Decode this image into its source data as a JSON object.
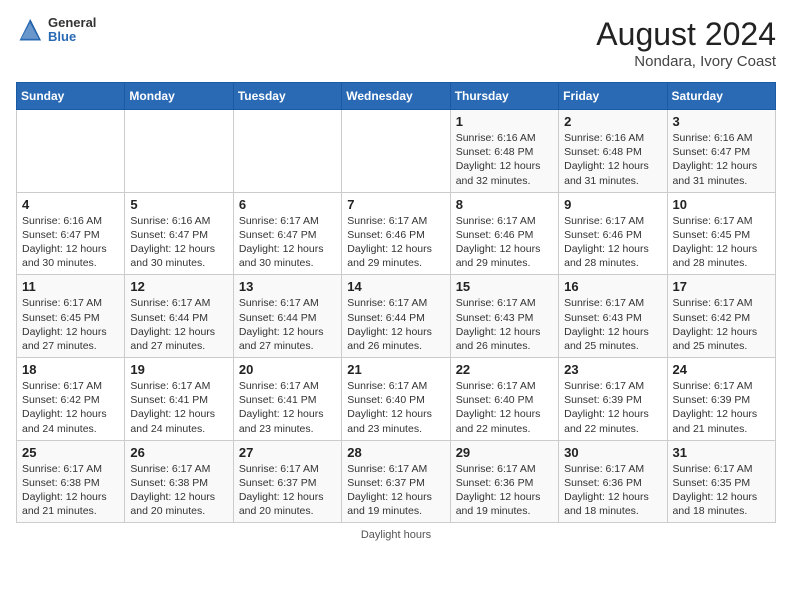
{
  "header": {
    "logo_general": "General",
    "logo_blue": "Blue",
    "month_year": "August 2024",
    "location": "Nondara, Ivory Coast"
  },
  "days_of_week": [
    "Sunday",
    "Monday",
    "Tuesday",
    "Wednesday",
    "Thursday",
    "Friday",
    "Saturday"
  ],
  "weeks": [
    [
      {
        "day": "",
        "text": ""
      },
      {
        "day": "",
        "text": ""
      },
      {
        "day": "",
        "text": ""
      },
      {
        "day": "",
        "text": ""
      },
      {
        "day": "1",
        "text": "Sunrise: 6:16 AM\nSunset: 6:48 PM\nDaylight: 12 hours\nand 32 minutes."
      },
      {
        "day": "2",
        "text": "Sunrise: 6:16 AM\nSunset: 6:48 PM\nDaylight: 12 hours\nand 31 minutes."
      },
      {
        "day": "3",
        "text": "Sunrise: 6:16 AM\nSunset: 6:47 PM\nDaylight: 12 hours\nand 31 minutes."
      }
    ],
    [
      {
        "day": "4",
        "text": "Sunrise: 6:16 AM\nSunset: 6:47 PM\nDaylight: 12 hours\nand 30 minutes."
      },
      {
        "day": "5",
        "text": "Sunrise: 6:16 AM\nSunset: 6:47 PM\nDaylight: 12 hours\nand 30 minutes."
      },
      {
        "day": "6",
        "text": "Sunrise: 6:17 AM\nSunset: 6:47 PM\nDaylight: 12 hours\nand 30 minutes."
      },
      {
        "day": "7",
        "text": "Sunrise: 6:17 AM\nSunset: 6:46 PM\nDaylight: 12 hours\nand 29 minutes."
      },
      {
        "day": "8",
        "text": "Sunrise: 6:17 AM\nSunset: 6:46 PM\nDaylight: 12 hours\nand 29 minutes."
      },
      {
        "day": "9",
        "text": "Sunrise: 6:17 AM\nSunset: 6:46 PM\nDaylight: 12 hours\nand 28 minutes."
      },
      {
        "day": "10",
        "text": "Sunrise: 6:17 AM\nSunset: 6:45 PM\nDaylight: 12 hours\nand 28 minutes."
      }
    ],
    [
      {
        "day": "11",
        "text": "Sunrise: 6:17 AM\nSunset: 6:45 PM\nDaylight: 12 hours\nand 27 minutes."
      },
      {
        "day": "12",
        "text": "Sunrise: 6:17 AM\nSunset: 6:44 PM\nDaylight: 12 hours\nand 27 minutes."
      },
      {
        "day": "13",
        "text": "Sunrise: 6:17 AM\nSunset: 6:44 PM\nDaylight: 12 hours\nand 27 minutes."
      },
      {
        "day": "14",
        "text": "Sunrise: 6:17 AM\nSunset: 6:44 PM\nDaylight: 12 hours\nand 26 minutes."
      },
      {
        "day": "15",
        "text": "Sunrise: 6:17 AM\nSunset: 6:43 PM\nDaylight: 12 hours\nand 26 minutes."
      },
      {
        "day": "16",
        "text": "Sunrise: 6:17 AM\nSunset: 6:43 PM\nDaylight: 12 hours\nand 25 minutes."
      },
      {
        "day": "17",
        "text": "Sunrise: 6:17 AM\nSunset: 6:42 PM\nDaylight: 12 hours\nand 25 minutes."
      }
    ],
    [
      {
        "day": "18",
        "text": "Sunrise: 6:17 AM\nSunset: 6:42 PM\nDaylight: 12 hours\nand 24 minutes."
      },
      {
        "day": "19",
        "text": "Sunrise: 6:17 AM\nSunset: 6:41 PM\nDaylight: 12 hours\nand 24 minutes."
      },
      {
        "day": "20",
        "text": "Sunrise: 6:17 AM\nSunset: 6:41 PM\nDaylight: 12 hours\nand 23 minutes."
      },
      {
        "day": "21",
        "text": "Sunrise: 6:17 AM\nSunset: 6:40 PM\nDaylight: 12 hours\nand 23 minutes."
      },
      {
        "day": "22",
        "text": "Sunrise: 6:17 AM\nSunset: 6:40 PM\nDaylight: 12 hours\nand 22 minutes."
      },
      {
        "day": "23",
        "text": "Sunrise: 6:17 AM\nSunset: 6:39 PM\nDaylight: 12 hours\nand 22 minutes."
      },
      {
        "day": "24",
        "text": "Sunrise: 6:17 AM\nSunset: 6:39 PM\nDaylight: 12 hours\nand 21 minutes."
      }
    ],
    [
      {
        "day": "25",
        "text": "Sunrise: 6:17 AM\nSunset: 6:38 PM\nDaylight: 12 hours\nand 21 minutes."
      },
      {
        "day": "26",
        "text": "Sunrise: 6:17 AM\nSunset: 6:38 PM\nDaylight: 12 hours\nand 20 minutes."
      },
      {
        "day": "27",
        "text": "Sunrise: 6:17 AM\nSunset: 6:37 PM\nDaylight: 12 hours\nand 20 minutes."
      },
      {
        "day": "28",
        "text": "Sunrise: 6:17 AM\nSunset: 6:37 PM\nDaylight: 12 hours\nand 19 minutes."
      },
      {
        "day": "29",
        "text": "Sunrise: 6:17 AM\nSunset: 6:36 PM\nDaylight: 12 hours\nand 19 minutes."
      },
      {
        "day": "30",
        "text": "Sunrise: 6:17 AM\nSunset: 6:36 PM\nDaylight: 12 hours\nand 18 minutes."
      },
      {
        "day": "31",
        "text": "Sunrise: 6:17 AM\nSunset: 6:35 PM\nDaylight: 12 hours\nand 18 minutes."
      }
    ]
  ],
  "daylight_label": "Daylight hours"
}
